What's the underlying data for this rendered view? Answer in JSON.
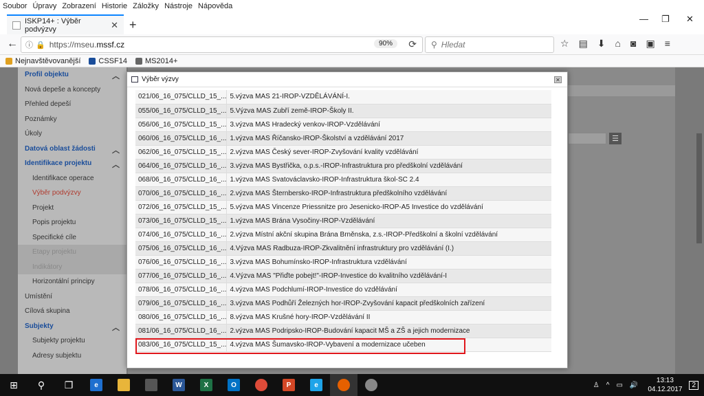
{
  "menu": [
    "Soubor",
    "Úpravy",
    "Zobrazení",
    "Historie",
    "Záložky",
    "Nástroje",
    "Nápověda"
  ],
  "tab": {
    "title": "ISKP14+ : Výběr podvýzvy"
  },
  "address": {
    "prefix": "https://mseu.",
    "domain": "mssf.cz",
    "zoom": "90%"
  },
  "search": {
    "placeholder": "Hledat"
  },
  "bookmarks": [
    "Nejnavštěvovanější",
    "CSSF14",
    "MS2014+"
  ],
  "sidebar": {
    "items": [
      {
        "label": "Profil objektu",
        "type": "head"
      },
      {
        "label": "Nová depeše a koncepty",
        "type": "item"
      },
      {
        "label": "Přehled depeší",
        "type": "item"
      },
      {
        "label": "Poznámky",
        "type": "item"
      },
      {
        "label": "Úkoly",
        "type": "item"
      },
      {
        "label": "Datová oblast žádosti",
        "type": "head"
      },
      {
        "label": "Identifikace projektu",
        "type": "head"
      },
      {
        "label": "Identifikace operace",
        "type": "sub"
      },
      {
        "label": "Výběr podvýzvy",
        "type": "sub-active"
      },
      {
        "label": "Projekt",
        "type": "sub"
      },
      {
        "label": "Popis projektu",
        "type": "sub"
      },
      {
        "label": "Specifické cíle",
        "type": "sub"
      },
      {
        "label": "Etapy projektu",
        "type": "sub-disabled"
      },
      {
        "label": "Indikátory",
        "type": "sub-disabled"
      },
      {
        "label": "Horizontální principy",
        "type": "sub"
      },
      {
        "label": "Umístění",
        "type": "item"
      },
      {
        "label": "Cílová skupina",
        "type": "item"
      },
      {
        "label": "Subjekty",
        "type": "head"
      },
      {
        "label": "Subjekty projektu",
        "type": "sub"
      },
      {
        "label": "Adresy subjektu",
        "type": "sub"
      }
    ]
  },
  "modal": {
    "title": "Výběr výzvy",
    "rows": [
      {
        "code": "021/06_16_075/CLLD_15_...",
        "name": "5.výzva MAS 21-IROP-VZDĚLÁVÁNÍ-I."
      },
      {
        "code": "055/06_16_075/CLLD_15_...",
        "name": "5.Výzva MAS Zubří země-IROP-Školy II."
      },
      {
        "code": "056/06_16_075/CLLD_15_...",
        "name": "3.výzva MAS Hradecký venkov-IROP-Vzdělávání"
      },
      {
        "code": "060/06_16_075/CLLD_16_...",
        "name": "1.výzva MAS Říčansko-IROP-Školství a vzdělávání 2017"
      },
      {
        "code": "062/06_16_075/CLLD_15_...",
        "name": "2.výzva MAS Český sever-IROP-Zvyšování kvality vzdělávání"
      },
      {
        "code": "064/06_16_075/CLLD_16_...",
        "name": "3.výzva MAS Bystřička, o.p.s.-IROP-Infrastruktura pro předškolní vzdělávání"
      },
      {
        "code": "068/06_16_075/CLLD_16_...",
        "name": "1.výzva MAS Svatováclavsko-IROP-Infrastruktura škol-SC 2.4"
      },
      {
        "code": "070/06_16_075/CLLD_16_...",
        "name": "2.výzva MAS Šternbersko-IROP-Infrastruktura předškolního vzdělávání"
      },
      {
        "code": "072/06_16_075/CLLD_15_...",
        "name": "5.výzva MAS Vincenze Priessnitze pro Jesenicko-IROP-A5 Investice do vzdělávání"
      },
      {
        "code": "073/06_16_075/CLLD_15_...",
        "name": "1.výzva MAS Brána Vysočiny-IROP-Vzdělávání"
      },
      {
        "code": "074/06_16_075/CLLD_16_...",
        "name": "2.výzva Místní akční skupina Brána Brněnska, z.s.-IROP-Předškolní a školní vzdělávání"
      },
      {
        "code": "075/06_16_075/CLLD_16_...",
        "name": "4.Výzva MAS Radbuza-IROP-Zkvalitnění infrastruktury pro vzdělávání (I.)"
      },
      {
        "code": "076/06_16_075/CLLD_16_...",
        "name": "3.výzva MAS Bohumínsko-IROP-Infrastruktura vzdělávání"
      },
      {
        "code": "077/06_16_075/CLLD_16_...",
        "name": "4.Výzva MAS \"Přiďte pobejt!\"-IROP-Investice do kvalitního vzdělávání-I"
      },
      {
        "code": "078/06_16_075/CLLD_16_...",
        "name": "4.výzva MAS Podchlumí-IROP-Investice do vzdělávání"
      },
      {
        "code": "079/06_16_075/CLLD_16_...",
        "name": "3.výzva MAS Podhůří Železných hor-IROP-Zvyšování kapacit předškolních zařízení"
      },
      {
        "code": "080/06_16_075/CLLD_16_...",
        "name": "8.výzva MAS Krušné hory-IROP-Vzdělávání II"
      },
      {
        "code": "081/06_16_075/CLLD_16_...",
        "name": "2.výzva MAS Podripsko-IROP-Budování kapacit MŠ a ZŠ a jejich modernizace"
      },
      {
        "code": "083/06_16_075/CLLD_15_...",
        "name": "4.výzva MAS Šumavsko-IROP-Vybavení a modernizace učeben"
      }
    ]
  },
  "taskbar": {
    "time": "13:13",
    "date": "04.12.2017",
    "notifications": "2"
  }
}
